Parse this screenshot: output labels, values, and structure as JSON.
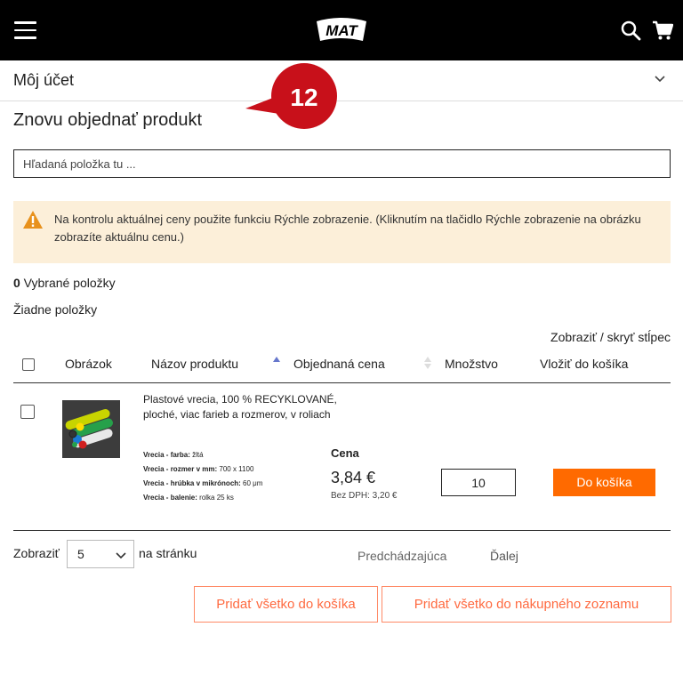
{
  "header": {
    "logo_text": "MAT"
  },
  "account": {
    "title": "Môj účet"
  },
  "badge": {
    "number": "12"
  },
  "page": {
    "title": "Znovu objednať produkt"
  },
  "search": {
    "placeholder": "Hľadaná položka tu ..."
  },
  "alert": {
    "text": "Na kontrolu aktuálnej ceny použite funkciu Rýchle zobrazenie. (Kliknutím na tlačidlo Rýchle zobrazenie na obrázku zobrazíte aktuálnu cenu.)"
  },
  "selection": {
    "count": "0",
    "label": " Vybrané položky",
    "empty_text": "Žiadne položky"
  },
  "table": {
    "toggle_columns": "Zobraziť / skryť stĺpec",
    "headers": {
      "image": "Obrázok",
      "name": "Názov produktu",
      "price": "Objednaná cena",
      "quantity": "Množstvo",
      "add": "Vložiť do košíka"
    },
    "rows": [
      {
        "name": "Plastové vrecia, 100 % RECYKLOVANÉ, ploché, viac farieb a rozmerov, v roliach",
        "attributes": [
          {
            "key": "Vrecia - farba:",
            "value": "žltá"
          },
          {
            "key": "Vrecia - rozmer v mm:",
            "value": "700 x 1100"
          },
          {
            "key": "Vrecia - hrúbka v mikrónoch:",
            "value": "60 μm"
          },
          {
            "key": "Vrecia - balenie:",
            "value": "rolka 25 ks"
          }
        ],
        "price_label": "Cena",
        "price": "3,84 €",
        "price_net": "Bez DPH: 3,20 €",
        "quantity": "10",
        "add_button": "Do košíka"
      }
    ]
  },
  "pagination": {
    "show_label": "Zobraziť",
    "per_page_value": "5",
    "per_page_suffix": "na stránku",
    "previous": "Predchádzajúca",
    "next": "Ďalej"
  },
  "actions": {
    "add_all_cart": "Pridať všetko do košíka",
    "add_all_list": "Pridať všetko do nákupného zoznamu"
  },
  "colors": {
    "accent": "#ff6a00",
    "badge": "#c8101a",
    "alert_bg": "#fcefd9",
    "alert_icon": "#e8911c"
  }
}
